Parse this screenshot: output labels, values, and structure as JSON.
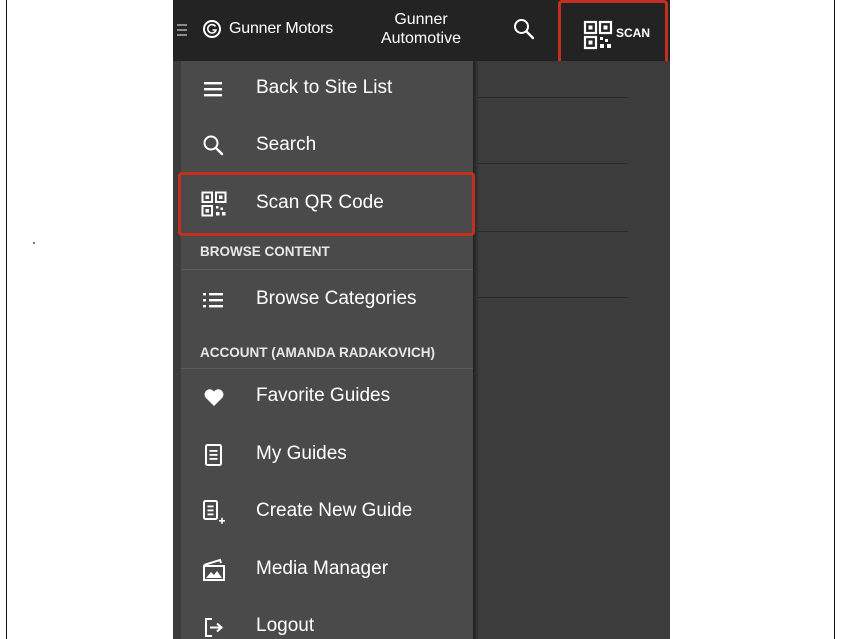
{
  "header": {
    "brand": "Gunner Motors",
    "site_line1": "Gunner",
    "site_line2": "Automotive",
    "scan_label": "SCAN"
  },
  "menu": {
    "back": "Back to Site List",
    "search": "Search",
    "scan_qr": "Scan QR Code",
    "browse_section": "BROWSE CONTENT",
    "browse_categories": "Browse Categories",
    "account_section": "ACCOUNT (AMANDA RADAKOVICH)",
    "favorite_guides": "Favorite Guides",
    "my_guides": "My Guides",
    "create_new_guide": "Create New Guide",
    "media_manager": "Media Manager",
    "logout": "Logout"
  },
  "colors": {
    "topbar": "#232323",
    "drawer": "#4a4a4a",
    "highlight": "#c4301f"
  }
}
